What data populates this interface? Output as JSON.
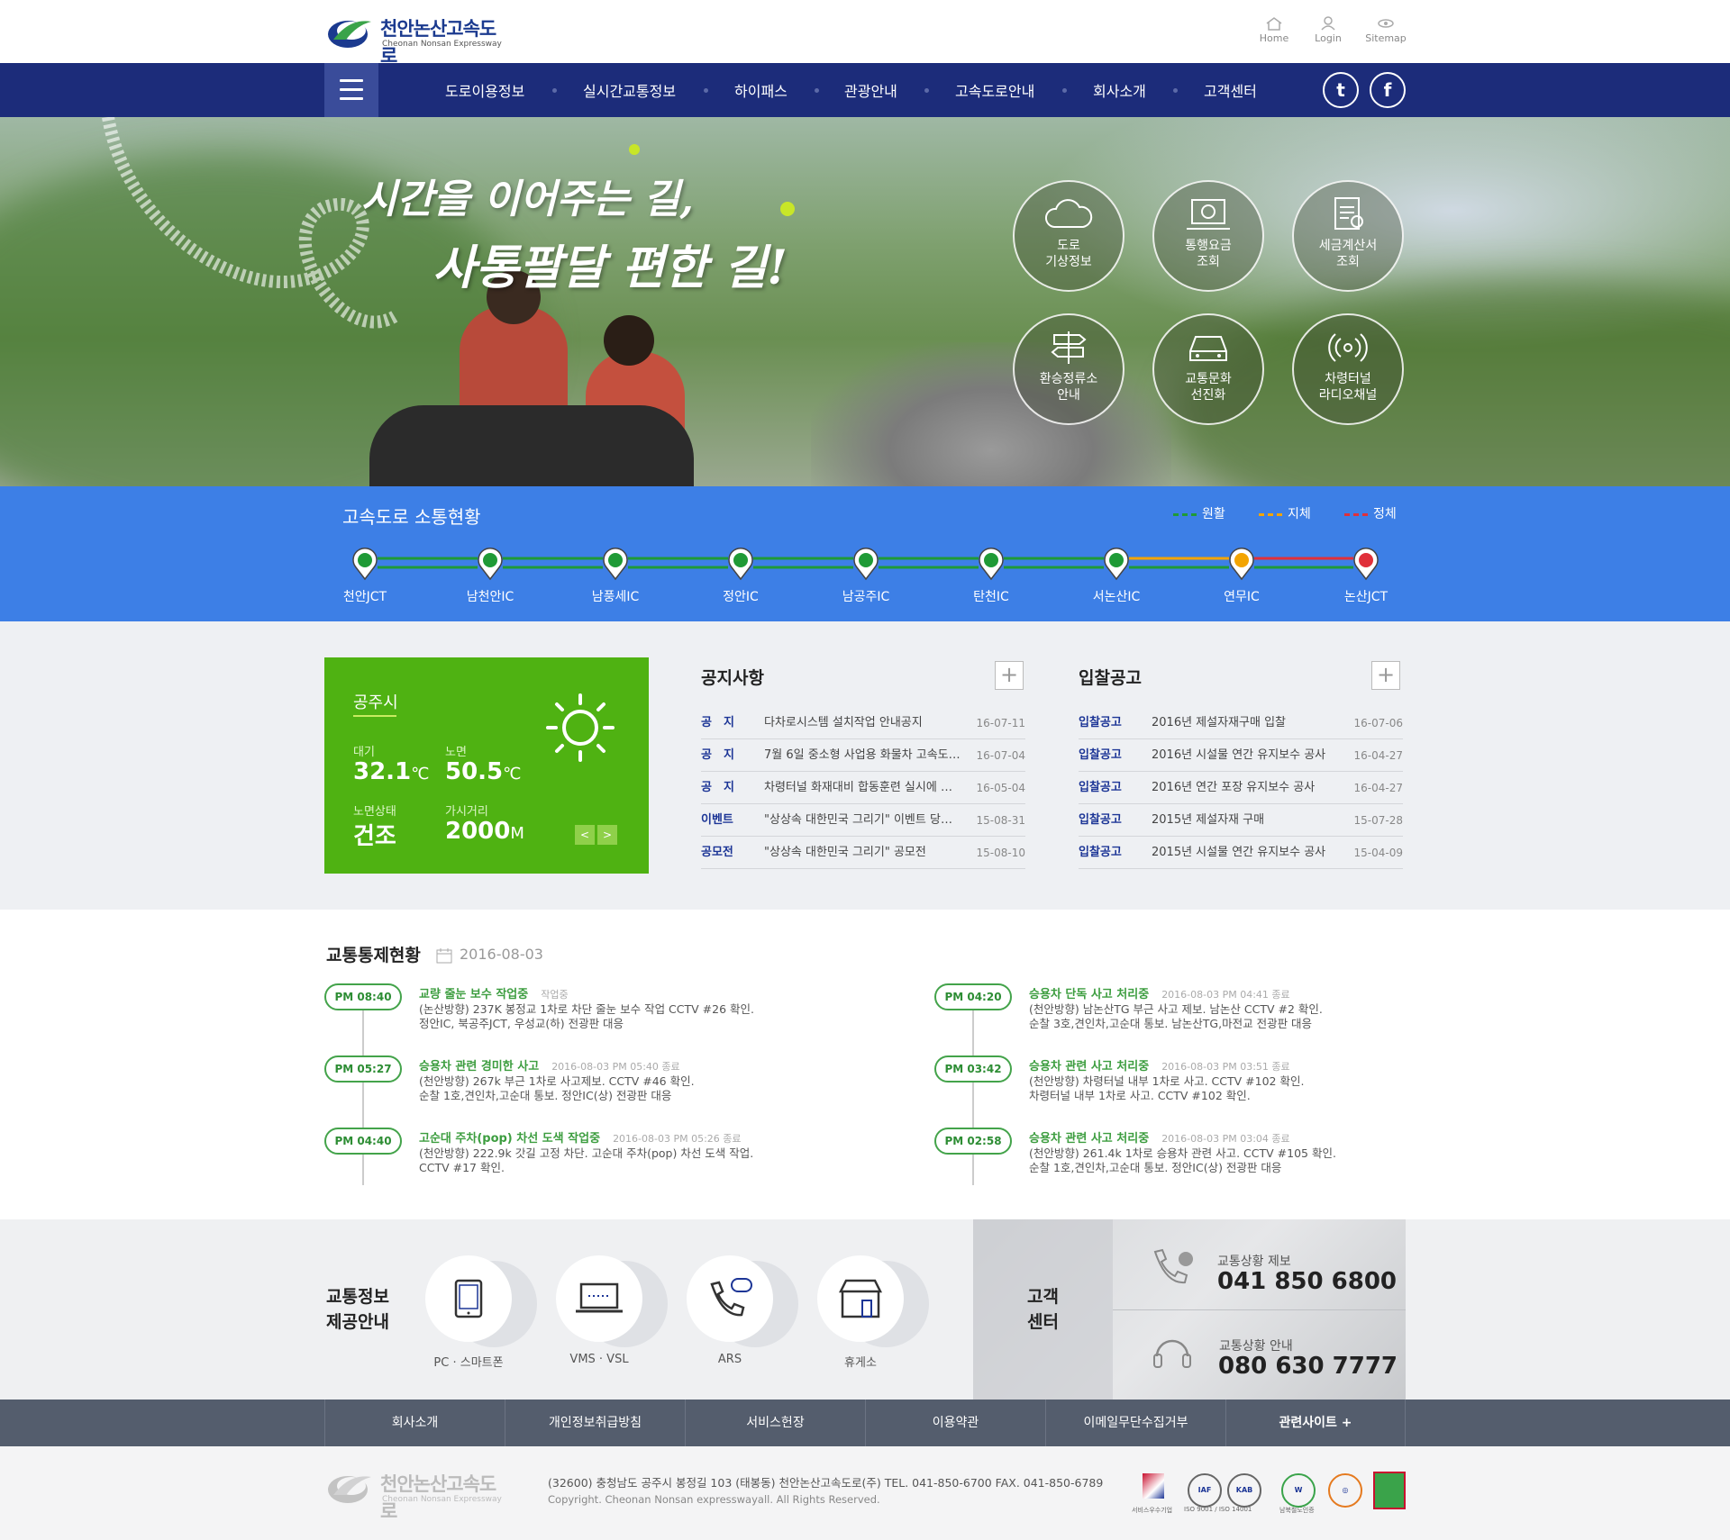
{
  "header": {
    "logo_title": "천안논산고속도로",
    "logo_sub": "Cheonan Nonsan Expressway",
    "util": [
      "Home",
      "Login",
      "Sitemap"
    ]
  },
  "nav": {
    "items": [
      "도로이용정보",
      "실시간교통정보",
      "하이패스",
      "관광안내",
      "고속도로안내",
      "회사소개",
      "고객센터"
    ],
    "twitter": "t",
    "facebook": "f"
  },
  "hero": {
    "slogan1": "시간을 이어주는 길,",
    "slogan2": "사통팔달 편한 길!",
    "quick": [
      {
        "l1": "도로",
        "l2": "기상정보",
        "icon": "cloud-icon"
      },
      {
        "l1": "통행요금",
        "l2": "조회",
        "icon": "toll-icon"
      },
      {
        "l1": "세금계산서",
        "l2": "조회",
        "icon": "invoice-icon"
      },
      {
        "l1": "환승정류소",
        "l2": "안내",
        "icon": "signpost-icon"
      },
      {
        "l1": "교통문화",
        "l2": "선진화",
        "icon": "car-icon"
      },
      {
        "l1": "차령터널",
        "l2": "라디오채널",
        "icon": "radio-icon"
      }
    ]
  },
  "traffic": {
    "title": "고속도로 소통현황",
    "legend": [
      {
        "label": "원활",
        "color": "#1f9a36"
      },
      {
        "label": "지체",
        "color": "#f3a400"
      },
      {
        "label": "정체",
        "color": "#e0303a"
      }
    ],
    "ics": [
      "천안JCT",
      "남천안IC",
      "남풍세IC",
      "정안IC",
      "남공주IC",
      "탄천IC",
      "서논산IC",
      "연무IC",
      "논산JCT"
    ],
    "status": [
      "green",
      "green",
      "green",
      "green",
      "green",
      "green",
      "green",
      "orange",
      "red"
    ]
  },
  "weather": {
    "city": "공주시",
    "air_label": "대기",
    "air_value": "32.1",
    "air_unit": "℃",
    "road_label": "노면",
    "road_value": "50.5",
    "road_unit": "℃",
    "cond_label": "노면상태",
    "cond_value": "건조",
    "vis_label": "가시거리",
    "vis_value": "2000",
    "vis_unit": "M",
    "prev": "<",
    "next": ">"
  },
  "notice": {
    "title": "공지사항",
    "plus": "+",
    "rows": [
      {
        "cat": "공　지",
        "subject": "다차로시스템 설치작업 안내공지",
        "date": "16-07-11"
      },
      {
        "cat": "공　지",
        "subject": "7월 6일 중소형 사업용 화물차 고속도 ...",
        "date": "16-07-04"
      },
      {
        "cat": "공　지",
        "subject": "차령터널 화재대비 합동훈련 실시에 따 ...",
        "date": "16-05-04"
      },
      {
        "cat": "이벤트",
        "subject": "\"상상속 대한민국 그리기\" 이벤트 당첨 ...",
        "date": "15-08-31"
      },
      {
        "cat": "공모전",
        "subject": "\"상상속 대한민국 그리기\" 공모전",
        "date": "15-08-10"
      }
    ]
  },
  "bid": {
    "title": "입찰공고",
    "plus": "+",
    "rows": [
      {
        "cat": "입찰공고",
        "subject": "2016년 제설자재구매 입찰",
        "date": "16-07-06"
      },
      {
        "cat": "입찰공고",
        "subject": "2016년 시설물 연간 유지보수 공사",
        "date": "16-04-27"
      },
      {
        "cat": "입찰공고",
        "subject": "2016년 연간 포장 유지보수 공사",
        "date": "16-04-27"
      },
      {
        "cat": "입찰공고",
        "subject": "2015년 제설자재 구매",
        "date": "15-07-28"
      },
      {
        "cat": "입찰공고",
        "subject": "2015년 시설물 연간 유지보수 공사",
        "date": "15-04-09"
      }
    ]
  },
  "control": {
    "title": "교통통제현황",
    "date": "2016-08-03",
    "left": [
      {
        "time": "PM 08:40",
        "title": "교량 줄눈 보수 작업중",
        "status": "작업중",
        "l1": "(논산방향) 237K 봉정교 1차로 차단 줄눈 보수 작업 CCTV #26 확인.",
        "l2": "정안IC, 북공주JCT, 우성교(하) 전광판 대응"
      },
      {
        "time": "PM 05:27",
        "title": "승용차 관련 경미한 사고",
        "status": "2016-08-03 PM 05:40 종료",
        "l1": "(천안방향) 267k 부근 1차로 사고제보. CCTV #46 확인.",
        "l2": "순찰 1호,견인차,고순대 통보. 정안IC(상) 전광판 대응"
      },
      {
        "time": "PM 04:40",
        "title": "고순대 주차(pop) 차선 도색 작업중",
        "status": "2016-08-03 PM 05:26 종료",
        "l1": "(천안방향) 222.9k 갓길 고정 차단. 고순대 주차(pop) 차선 도색 작업.",
        "l2": "CCTV #17 확인."
      }
    ],
    "right": [
      {
        "time": "PM 04:20",
        "title": "승용차 단독 사고 처리중",
        "status": "2016-08-03 PM 04:41 종료",
        "l1": "(천안방향) 남논산TG 부근 사고 제보. 남논산 CCTV #2 확인.",
        "l2": "순찰 3호,견인차,고순대 통보. 남논산TG,마전교 전광판 대응"
      },
      {
        "time": "PM 03:42",
        "title": "승용차 관련 사고 처리중",
        "status": "2016-08-03 PM 03:51 종료",
        "l1": "(천안방향) 차령터널 내부 1차로 사고. CCTV #102 확인.",
        "l2": "차령터널 내부 1차로 사고. CCTV #102 확인."
      },
      {
        "time": "PM 02:58",
        "title": "승용차 관련 사고 처리중",
        "status": "2016-08-03 PM 03:04 종료",
        "l1": "(천안방향) 261.4k 1차로 승용차 관련 사고. CCTV #105 확인.",
        "l2": "순찰 1호,견인차,고순대 통보. 정안IC(상) 전광판 대응"
      }
    ]
  },
  "info": {
    "title1": "교통정보",
    "title2": "제공안내",
    "items": [
      {
        "label": "PC · 스마트폰",
        "icon": "tablet-icon"
      },
      {
        "label": "VMS · VSL",
        "icon": "laptop-icon"
      },
      {
        "label": "ARS",
        "icon": "phone-icon"
      },
      {
        "label": "휴게소",
        "icon": "store-icon"
      }
    ]
  },
  "customer": {
    "title1": "고객",
    "title2": "센터",
    "report_label": "교통상황 제보",
    "report_phone": "041 850 6800",
    "guide_label": "교통상황 안내",
    "guide_phone": "080 630 7777"
  },
  "footer": {
    "links": [
      "회사소개",
      "개인정보취급방침",
      "서비스헌장",
      "이용약관",
      "이메일무단수집거부",
      "관련사이트"
    ],
    "related_plus": "+",
    "address": "(32600) 충청남도 공주시 봉정길 103 (태봉동) 천안논산고속도로(주)  TEL. 041-850-6700  FAX. 041-850-6789",
    "copyright": "Copyright. Cheonan Nonsan expresswayall. All Rights Reserved.",
    "certs": [
      "서비스우수기업",
      "ISO 9001 / ISO 14001",
      "남북철도인증"
    ],
    "colors": {
      "nav": "#1c2c7a",
      "traffic": "#3d7fe6",
      "weather": "#4fb212",
      "footer": "#545d6d"
    }
  }
}
